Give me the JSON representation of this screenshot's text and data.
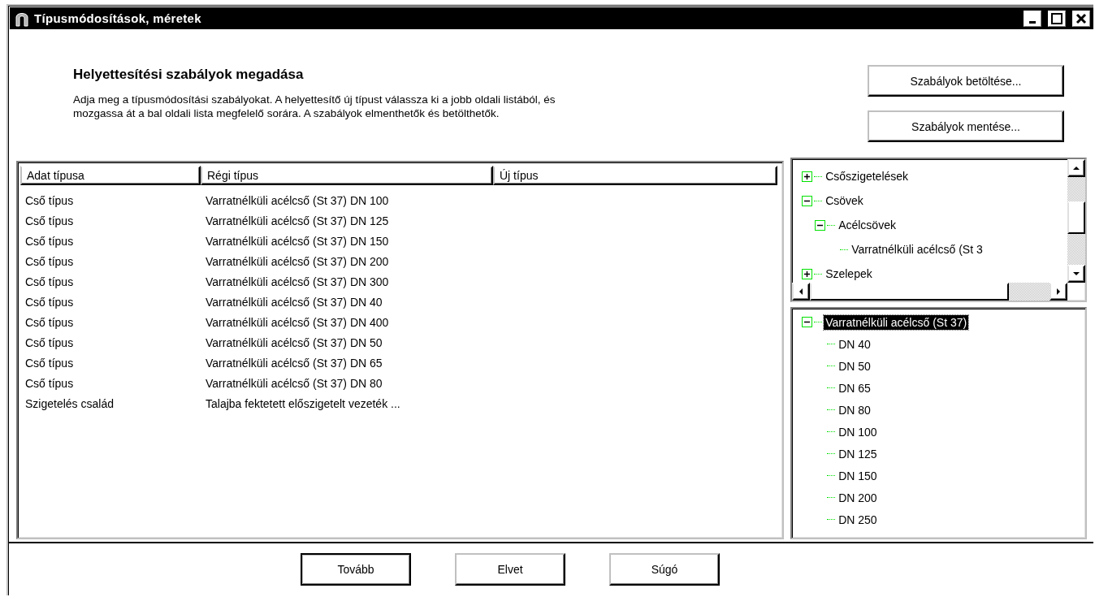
{
  "window": {
    "title": "Típusmódosítások, méretek"
  },
  "header": {
    "title": "Helyettesítési szabályok megadása",
    "description": "Adja meg a típusmódosítási szabályokat. A helyettesítő új típust válassza ki a jobb oldali listából, és\nmozgassa át a bal oldali lista megfelelő sorára. A szabályok elmenthetők és betölthetők."
  },
  "side_buttons": [
    "Szabályok betöltése...",
    "Szabályok mentése..."
  ],
  "table": {
    "columns": [
      "Adat típusa",
      "Régi típus",
      "Új típus"
    ],
    "rows": [
      [
        "Cső típus",
        "Varratnélküli acélcső (St 37) DN 100",
        ""
      ],
      [
        "Cső típus",
        "Varratnélküli acélcső (St 37) DN 125",
        ""
      ],
      [
        "Cső típus",
        "Varratnélküli acélcső (St 37) DN 150",
        ""
      ],
      [
        "Cső típus",
        "Varratnélküli acélcső (St 37) DN 200",
        ""
      ],
      [
        "Cső típus",
        "Varratnélküli acélcső (St 37) DN 300",
        ""
      ],
      [
        "Cső típus",
        "Varratnélküli acélcső (St 37) DN 40",
        ""
      ],
      [
        "Cső típus",
        "Varratnélküli acélcső (St 37) DN 400",
        ""
      ],
      [
        "Cső típus",
        "Varratnélküli acélcső (St 37) DN 50",
        ""
      ],
      [
        "Cső típus",
        "Varratnélküli acélcső (St 37) DN 65",
        ""
      ],
      [
        "Cső típus",
        "Varratnélküli acélcső (St 37) DN 80",
        ""
      ],
      [
        "Szigetelés család",
        "Talajba fektetett előszigetelt vezeték ...",
        ""
      ]
    ]
  },
  "category_tree": {
    "items": [
      {
        "label": "Csőszigetelések",
        "expanded": false
      },
      {
        "label": "Csövek",
        "expanded": true,
        "children": [
          {
            "label": "Acélcsövek",
            "expanded": true,
            "children": [
              {
                "label": "Varratnélküli acélcső (St 3"
              }
            ]
          }
        ]
      },
      {
        "label": "Szelepek",
        "expanded": false
      }
    ]
  },
  "size_tree": {
    "items": [
      {
        "label": "Varratnélküli acélcső (St 37)",
        "expanded": true,
        "selected": true,
        "children": [
          {
            "label": "DN 40",
            "selected": false
          },
          {
            "label": "DN 50",
            "selected": false
          },
          {
            "label": "DN 65",
            "selected": false
          },
          {
            "label": "DN 80",
            "selected": false
          },
          {
            "label": "DN 100",
            "selected": false
          },
          {
            "label": "DN 125",
            "selected": false
          },
          {
            "label": "DN 150",
            "selected": false
          },
          {
            "label": "DN 200",
            "selected": false
          },
          {
            "label": "DN 250",
            "selected": false
          }
        ]
      }
    ]
  },
  "buttons": [
    {
      "label": "Tovább",
      "default": true
    },
    {
      "label": "Elvet",
      "default": false
    },
    {
      "label": "Súgó",
      "default": false
    }
  ]
}
